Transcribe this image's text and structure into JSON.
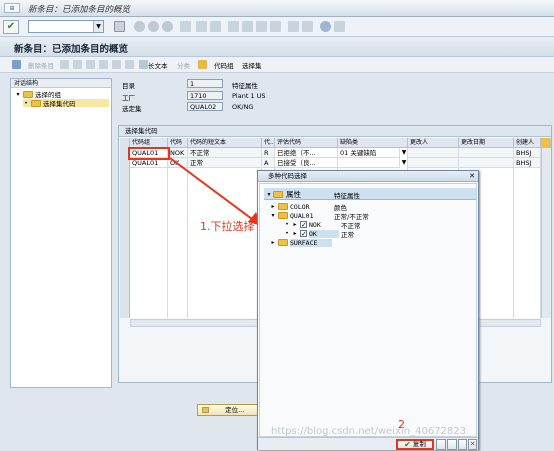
{
  "window_title": "新条目：已添加条目的概览",
  "page_title": "新条目：已添加条目的概览",
  "toolbar2": {
    "delete_item": "删除条目",
    "category": "分类",
    "long_text": "长文本",
    "code_group": "代码组",
    "select_set": "选择集"
  },
  "nav": {
    "header": "对话结构",
    "items": [
      {
        "label": "选择的组"
      },
      {
        "label": "选择集代码"
      }
    ]
  },
  "form": {
    "directory_label": "目录",
    "directory_value": "1",
    "directory_desc": "特征属性",
    "plant_label": "工厂",
    "plant_value": "1710",
    "plant_desc": "Plant 1 US",
    "selset_label": "选定集",
    "selset_value": "QUAL02",
    "selset_desc": "OK/NG"
  },
  "grid": {
    "title": "选择集代码",
    "headers": [
      "代码组",
      "代码",
      "代码的短文本",
      "代...",
      "评估代码",
      "缺陷类",
      "更改人",
      "更改日期",
      "创建人"
    ],
    "rows": [
      [
        "QUAL01",
        "NOK",
        "不正常",
        "R",
        "已拒绝（不...",
        "01 关键缺陷",
        "",
        "",
        "BHSJ"
      ],
      [
        "QUAL01",
        "OK",
        "正常",
        "A",
        "已接受（良...",
        "",
        "",
        "",
        "BHSJ"
      ]
    ]
  },
  "popup": {
    "title": "多种代码选择",
    "col_attr": "属性",
    "col_desc": "特征属性",
    "tree": [
      {
        "code": "COLOR",
        "desc": "颜色"
      },
      {
        "code": "QUAL01",
        "desc": "正常/不正常"
      },
      {
        "code": "NOK",
        "desc": "不正常"
      },
      {
        "code": "OK",
        "desc": "正常"
      },
      {
        "code": "SURFACE",
        "desc": ""
      }
    ],
    "copy_button": "复制"
  },
  "annotations": {
    "step1": "1.下拉选择",
    "step2": "2"
  },
  "position_button": "定位...",
  "watermark": "https://blog.csdn.net/weixin_40672823",
  "colors": {
    "annotation_red": "#e8341c",
    "folder_yellow": "#f0c040",
    "header_blue": "#cde0ef"
  }
}
